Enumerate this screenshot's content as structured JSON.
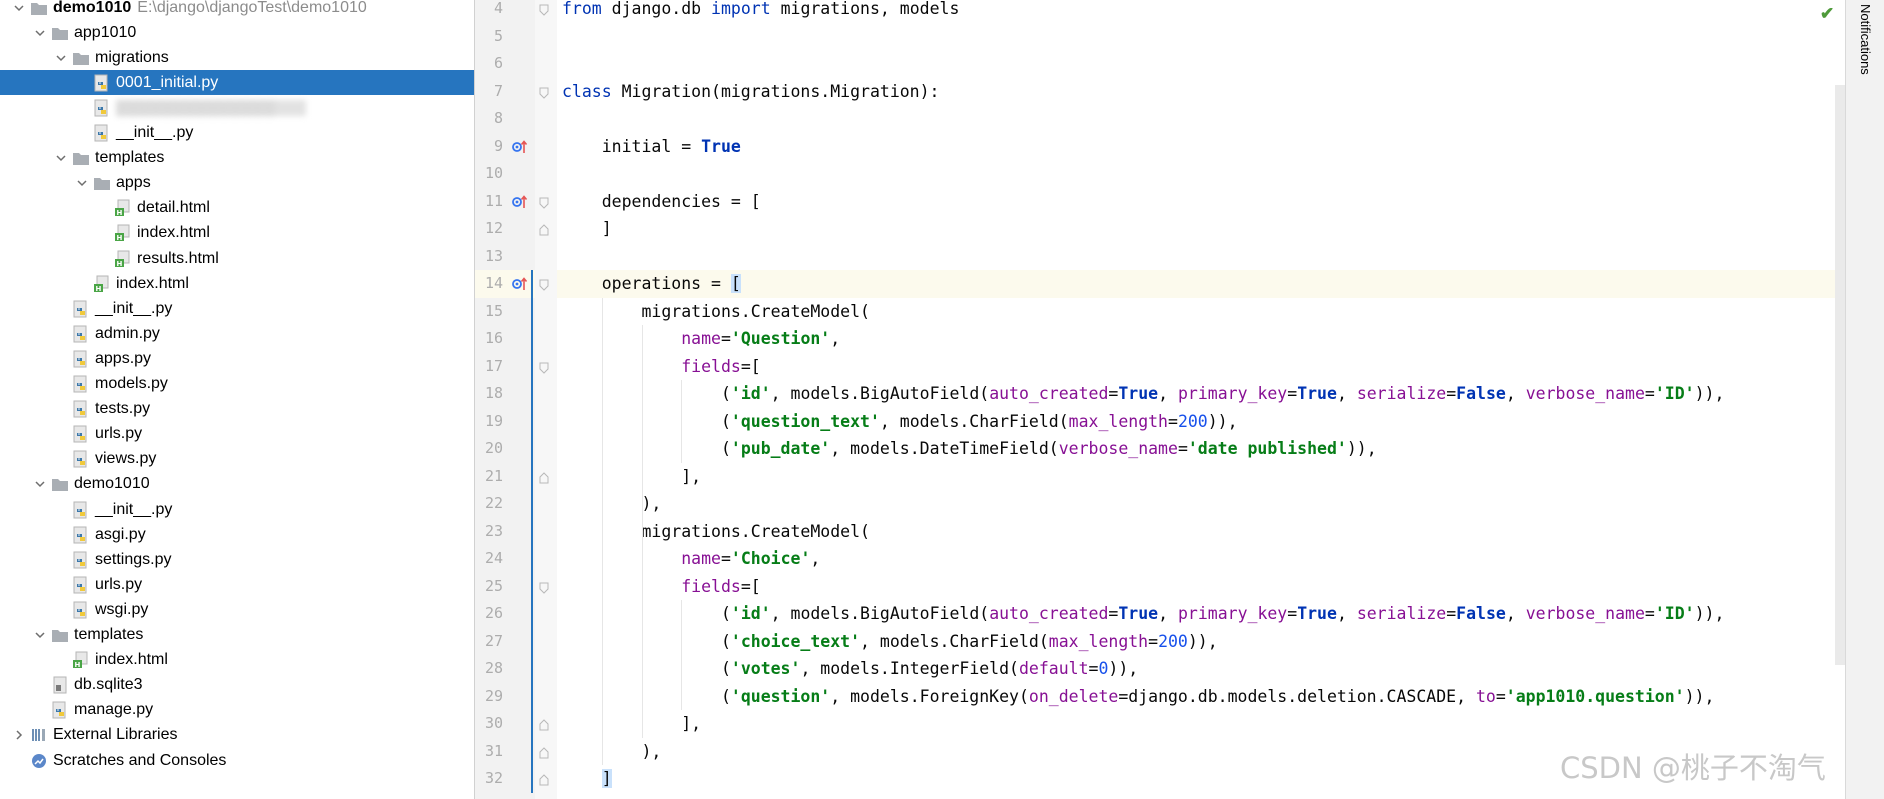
{
  "project": {
    "root_name": "demo1010",
    "root_path": "E:\\django\\djangoTest\\demo1010"
  },
  "tree": [
    {
      "label": "demo1010",
      "type": "folder",
      "depth": 0,
      "expanded": true,
      "bold": true,
      "path": "E:\\django\\djangoTest\\demo1010"
    },
    {
      "label": "app1010",
      "type": "folder",
      "depth": 1,
      "expanded": true
    },
    {
      "label": "migrations",
      "type": "folder",
      "depth": 2,
      "expanded": true
    },
    {
      "label": "0001_initial.py",
      "type": "py",
      "depth": 3,
      "selected": true
    },
    {
      "label": "",
      "type": "py",
      "depth": 3,
      "blurred": true
    },
    {
      "label": "__init__.py",
      "type": "py",
      "depth": 3
    },
    {
      "label": "templates",
      "type": "folder",
      "depth": 2,
      "expanded": true
    },
    {
      "label": "apps",
      "type": "folder",
      "depth": 3,
      "expanded": true
    },
    {
      "label": "detail.html",
      "type": "html",
      "depth": 4
    },
    {
      "label": "index.html",
      "type": "html",
      "depth": 4
    },
    {
      "label": "results.html",
      "type": "html",
      "depth": 4
    },
    {
      "label": "index.html",
      "type": "html",
      "depth": 3
    },
    {
      "label": "__init__.py",
      "type": "py",
      "depth": 2
    },
    {
      "label": "admin.py",
      "type": "py",
      "depth": 2
    },
    {
      "label": "apps.py",
      "type": "py",
      "depth": 2
    },
    {
      "label": "models.py",
      "type": "py",
      "depth": 2
    },
    {
      "label": "tests.py",
      "type": "py",
      "depth": 2
    },
    {
      "label": "urls.py",
      "type": "py",
      "depth": 2
    },
    {
      "label": "views.py",
      "type": "py",
      "depth": 2
    },
    {
      "label": "demo1010",
      "type": "folder",
      "depth": 1,
      "expanded": true
    },
    {
      "label": "__init__.py",
      "type": "py",
      "depth": 2
    },
    {
      "label": "asgi.py",
      "type": "py",
      "depth": 2
    },
    {
      "label": "settings.py",
      "type": "py",
      "depth": 2
    },
    {
      "label": "urls.py",
      "type": "py",
      "depth": 2
    },
    {
      "label": "wsgi.py",
      "type": "py",
      "depth": 2
    },
    {
      "label": "templates",
      "type": "folder",
      "depth": 1,
      "expanded": true
    },
    {
      "label": "index.html",
      "type": "html",
      "depth": 2
    },
    {
      "label": "db.sqlite3",
      "type": "db",
      "depth": 1
    },
    {
      "label": "manage.py",
      "type": "py",
      "depth": 1
    },
    {
      "label": "External Libraries",
      "type": "libs",
      "depth": 0,
      "expanded": false
    },
    {
      "label": "Scratches and Consoles",
      "type": "scratch",
      "depth": 0
    }
  ],
  "editor": {
    "current_line": 14,
    "lines": [
      {
        "n": 4,
        "text": "from django.db import migrations, models"
      },
      {
        "n": 5,
        "text": ""
      },
      {
        "n": 6,
        "text": ""
      },
      {
        "n": 7,
        "text": "class Migration(migrations.Migration):"
      },
      {
        "n": 8,
        "text": ""
      },
      {
        "n": 9,
        "text": "    initial = True",
        "marker": true
      },
      {
        "n": 10,
        "text": ""
      },
      {
        "n": 11,
        "text": "    dependencies = [",
        "marker": true
      },
      {
        "n": 12,
        "text": "    ]"
      },
      {
        "n": 13,
        "text": ""
      },
      {
        "n": 14,
        "text": "    operations = [",
        "marker": true
      },
      {
        "n": 15,
        "text": "        migrations.CreateModel("
      },
      {
        "n": 16,
        "text": "            name='Question',"
      },
      {
        "n": 17,
        "text": "            fields=["
      },
      {
        "n": 18,
        "text": "                ('id', models.BigAutoField(auto_created=True, primary_key=True, serialize=False, verbose_name='ID')),"
      },
      {
        "n": 19,
        "text": "                ('question_text', models.CharField(max_length=200)),"
      },
      {
        "n": 20,
        "text": "                ('pub_date', models.DateTimeField(verbose_name='date published')),"
      },
      {
        "n": 21,
        "text": "            ],"
      },
      {
        "n": 22,
        "text": "        ),"
      },
      {
        "n": 23,
        "text": "        migrations.CreateModel("
      },
      {
        "n": 24,
        "text": "            name='Choice',"
      },
      {
        "n": 25,
        "text": "            fields=["
      },
      {
        "n": 26,
        "text": "                ('id', models.BigAutoField(auto_created=True, primary_key=True, serialize=False, verbose_name='ID')),"
      },
      {
        "n": 27,
        "text": "                ('choice_text', models.CharField(max_length=200)),"
      },
      {
        "n": 28,
        "text": "                ('votes', models.IntegerField(default=0)),"
      },
      {
        "n": 29,
        "text": "                ('question', models.ForeignKey(on_delete=django.db.models.deletion.CASCADE, to='app1010.question')),"
      },
      {
        "n": 30,
        "text": "            ],"
      },
      {
        "n": 31,
        "text": "        ),"
      },
      {
        "n": 32,
        "text": "    ]"
      }
    ]
  },
  "right_panel": {
    "notifications_label": "Notifications"
  },
  "watermark": "CSDN @桃子不淘气",
  "colors": {
    "selection": "#2675bf",
    "keyword": "#0033b3",
    "string": "#067d17",
    "param": "#871094",
    "number": "#1750eb",
    "folder": "#a9aeb4",
    "python_blue": "#3c78aa",
    "python_yellow": "#f0c93c",
    "html_green": "#4aa546"
  }
}
